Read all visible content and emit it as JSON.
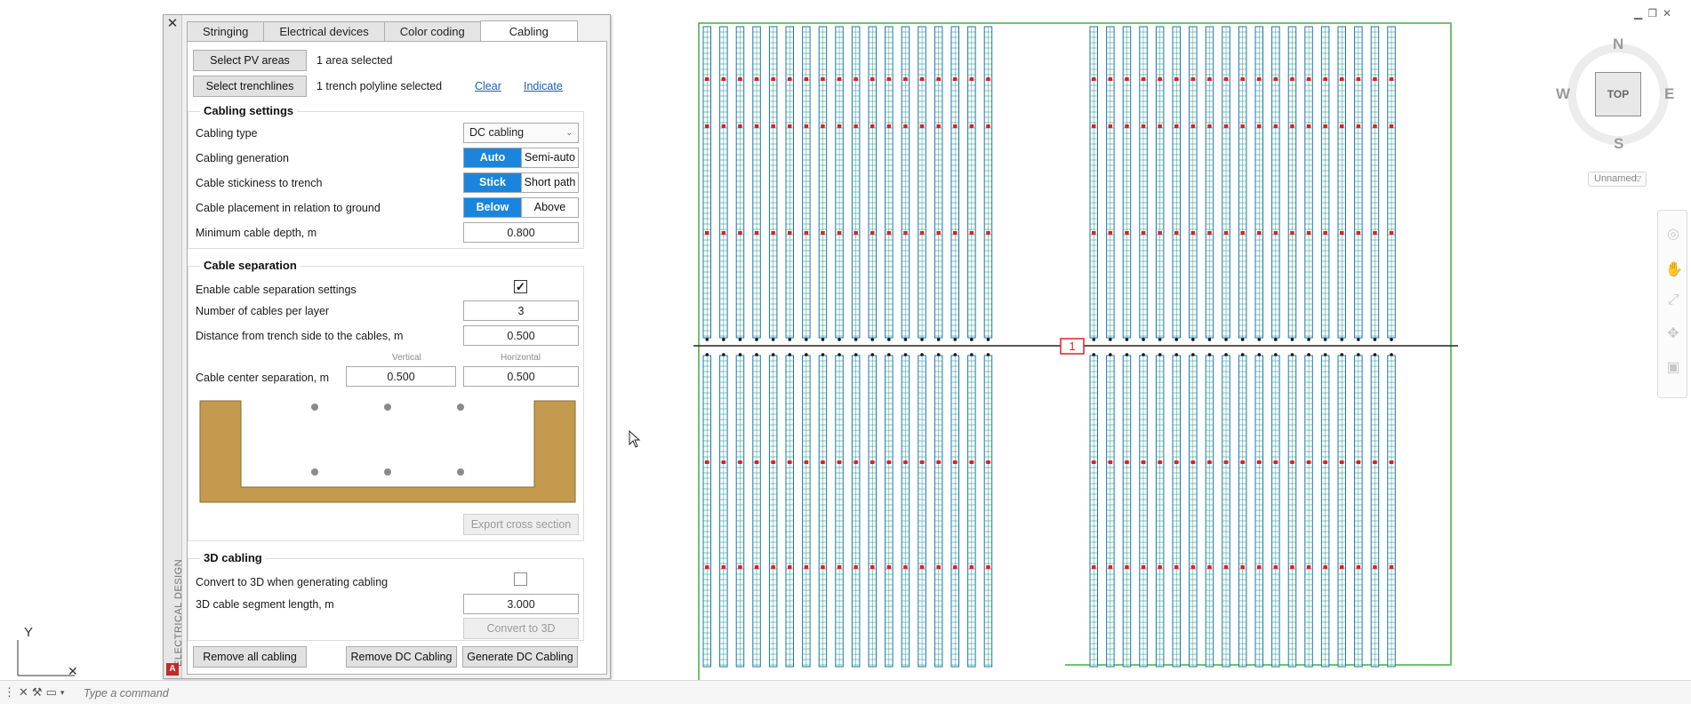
{
  "panel": {
    "side_label": "ELECTRICAL DESIGN",
    "tabs": [
      {
        "label": "Stringing",
        "active": false
      },
      {
        "label": "Electrical devices",
        "active": false
      },
      {
        "label": "Color coding",
        "active": false
      },
      {
        "label": "Cabling",
        "active": true
      }
    ],
    "selection": {
      "pv_button": "Select PV areas",
      "pv_status": "1 area selected",
      "trench_button": "Select trenchlines",
      "trench_status": "1 trench polyline selected",
      "clear_link": "Clear",
      "indicate_link": "Indicate"
    },
    "cabling_settings": {
      "title": "Cabling settings",
      "cabling_type_label": "Cabling type",
      "cabling_type_value": "DC cabling",
      "generation_label": "Cabling generation",
      "generation_options": [
        "Auto",
        "Semi-auto"
      ],
      "stickiness_label": "Cable stickiness to trench",
      "stickiness_options": [
        "Stick",
        "Short path"
      ],
      "placement_label": "Cable placement in relation to ground",
      "placement_options": [
        "Below",
        "Above"
      ],
      "min_depth_label": "Minimum cable depth, m",
      "min_depth_value": "0.800"
    },
    "cable_separation": {
      "title": "Cable separation",
      "enable_label": "Enable cable separation settings",
      "enabled": true,
      "cables_per_layer_label": "Number of cables per layer",
      "cables_per_layer_value": "3",
      "distance_label": "Distance from trench side to the cables, m",
      "distance_value": "0.500",
      "vertical_header": "Vertical",
      "horizontal_header": "Horizontal",
      "center_sep_label": "Cable center separation, m",
      "center_sep_vertical": "0.500",
      "center_sep_horizontal": "0.500",
      "export_button": "Export cross section"
    },
    "cabling_3d": {
      "title": "3D cabling",
      "convert_label": "Convert to 3D when generating cabling",
      "convert_enabled": false,
      "segment_label": "3D cable segment length, m",
      "segment_value": "3.000",
      "convert_button": "Convert to 3D"
    },
    "footer": {
      "remove_all": "Remove all cabling",
      "remove_dc": "Remove DC Cabling",
      "generate_dc": "Generate DC Cabling"
    }
  },
  "command_line": {
    "placeholder": "Type a command"
  },
  "viewcube": {
    "north": "N",
    "south": "S",
    "east": "E",
    "west": "W",
    "face": "TOP",
    "view_name": "Unnamed"
  },
  "ucs": {
    "y_label": "Y"
  },
  "drawing": {
    "trench_marker": "1"
  },
  "colors": {
    "accent": "#1a85dd",
    "module_rows": "#1b73b8",
    "module_grid": "#30a080",
    "boundary": "#3cb23c",
    "trench": "#222222",
    "trench_cross_section": "#c49a4e",
    "inverter_marker": "#e02020"
  }
}
